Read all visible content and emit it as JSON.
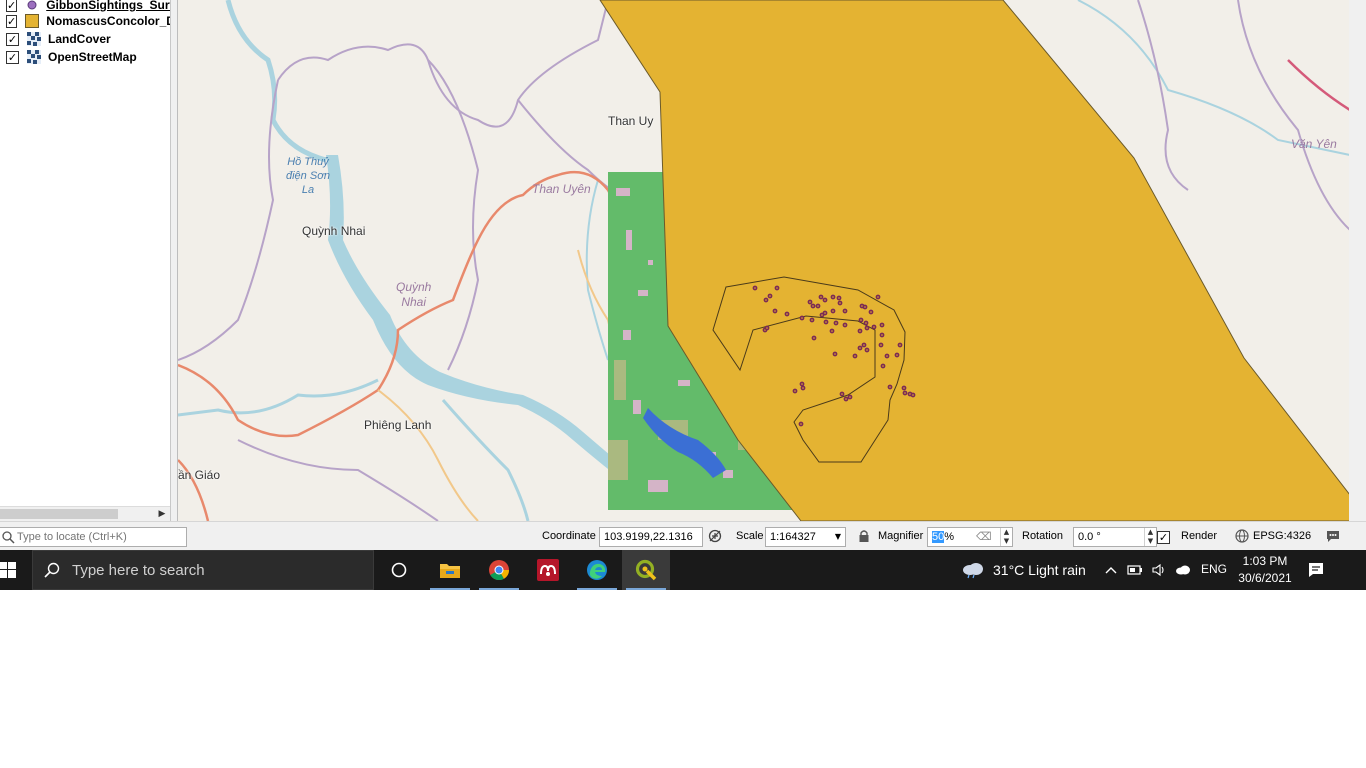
{
  "layers": [
    {
      "name": "GibbonSightings_Survey",
      "display": "GibbonSightings_Surv",
      "checked": true,
      "icon": "purple-point-icon",
      "style": "bold-underline"
    },
    {
      "name": "NomascusConcolor_Distribution",
      "display": "NomascusConcolor_Di",
      "checked": true,
      "icon": "yellow-polygon-icon",
      "style": "bold"
    },
    {
      "name": "LandCover",
      "display": "LandCover",
      "checked": true,
      "icon": "raster-icon",
      "style": "bold"
    },
    {
      "name": "OpenStreetMap",
      "display": "OpenStreetMap",
      "checked": true,
      "icon": "raster-icon",
      "style": "bold"
    }
  ],
  "check_mark": "✓",
  "map": {
    "places": {
      "than_uyen_town": "Than Uy",
      "than_uyen_district": "Than Uyên",
      "quynh_nhai_town": "Quỳnh Nhai",
      "quynh_nhai_district": "Quỳnh\nNhai",
      "ho_thuy_dien": "Hồ Thuỷ\nđiện Sơn\nLa",
      "phieng_lanh": "Phiêng Lanh",
      "tuan_giao": "ần Giáo",
      "van_yen": "Văn Yên"
    },
    "colors": {
      "distribution_polygon": "#e4b332",
      "landcover": "#63bb6a",
      "water": "#aad3df",
      "sightings": "#7a2a55"
    }
  },
  "status_bar": {
    "locator_placeholder": "Type to locate (Ctrl+K)",
    "coordinate_label": "Coordinate",
    "coordinate_value": "103.9199,22.1316",
    "scale_label": "Scale",
    "scale_value": "1:164327",
    "magnifier_label": "Magnifier",
    "magnifier_value": "50",
    "magnifier_suffix": "%",
    "rotation_label": "Rotation",
    "rotation_value": "0.0 °",
    "render_label": "Render",
    "render_checked": true,
    "crs": "EPSG:4326"
  },
  "taskbar": {
    "search_placeholder": "Type here to search",
    "apps": [
      "task-view",
      "file-explorer",
      "chrome",
      "mendeley",
      "edge",
      "qgis"
    ],
    "weather": "31°C  Light rain",
    "language": "ENG",
    "time": "1:03 PM",
    "date": "30/6/2021"
  }
}
